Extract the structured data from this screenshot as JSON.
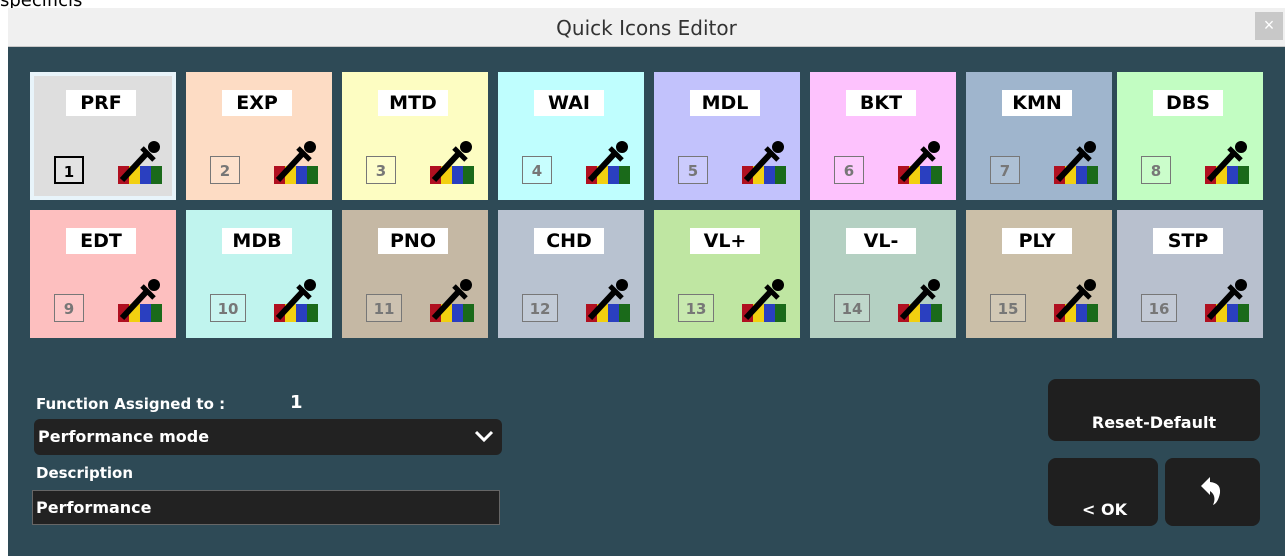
{
  "background": {
    "text": "specificis"
  },
  "window": {
    "title": "Quick Icons Editor",
    "close_label": "×"
  },
  "tiles": [
    {
      "code": "PRF",
      "num": "1",
      "color": "#dedede"
    },
    {
      "code": "EXP",
      "num": "2",
      "color": "#fddcc4"
    },
    {
      "code": "MTD",
      "num": "3",
      "color": "#fdfdc2"
    },
    {
      "code": "WAI",
      "num": "4",
      "color": "#bffefe"
    },
    {
      "code": "MDL",
      "num": "5",
      "color": "#c2c2fc"
    },
    {
      "code": "BKT",
      "num": "6",
      "color": "#fdc2fd"
    },
    {
      "code": "KMN",
      "num": "7",
      "color": "#9fb5cd"
    },
    {
      "code": "DBS",
      "num": "8",
      "color": "#c2fdc2"
    },
    {
      "code": "EDT",
      "num": "9",
      "color": "#fdbfbf"
    },
    {
      "code": "MDB",
      "num": "10",
      "color": "#c0f4ee"
    },
    {
      "code": "PNO",
      "num": "11",
      "color": "#c5b8a4"
    },
    {
      "code": "CHD",
      "num": "12",
      "color": "#b8c2d0"
    },
    {
      "code": "VL+",
      "num": "13",
      "color": "#bfe6a2"
    },
    {
      "code": "VL-",
      "num": "14",
      "color": "#b4d0c2"
    },
    {
      "code": "PLY",
      "num": "15",
      "color": "#cbbfa8"
    },
    {
      "code": "STP",
      "num": "16",
      "color": "#b8c0ce"
    }
  ],
  "selected_tile": "1",
  "function": {
    "label": "Function Assigned to :",
    "value": "1",
    "selected": "Performance mode"
  },
  "description": {
    "label": "Description",
    "value": "Performance"
  },
  "buttons": {
    "reset": "Reset-Default",
    "ok": "< OK"
  },
  "colors": {
    "panel": "#2e4a56",
    "dark": "#222222"
  }
}
